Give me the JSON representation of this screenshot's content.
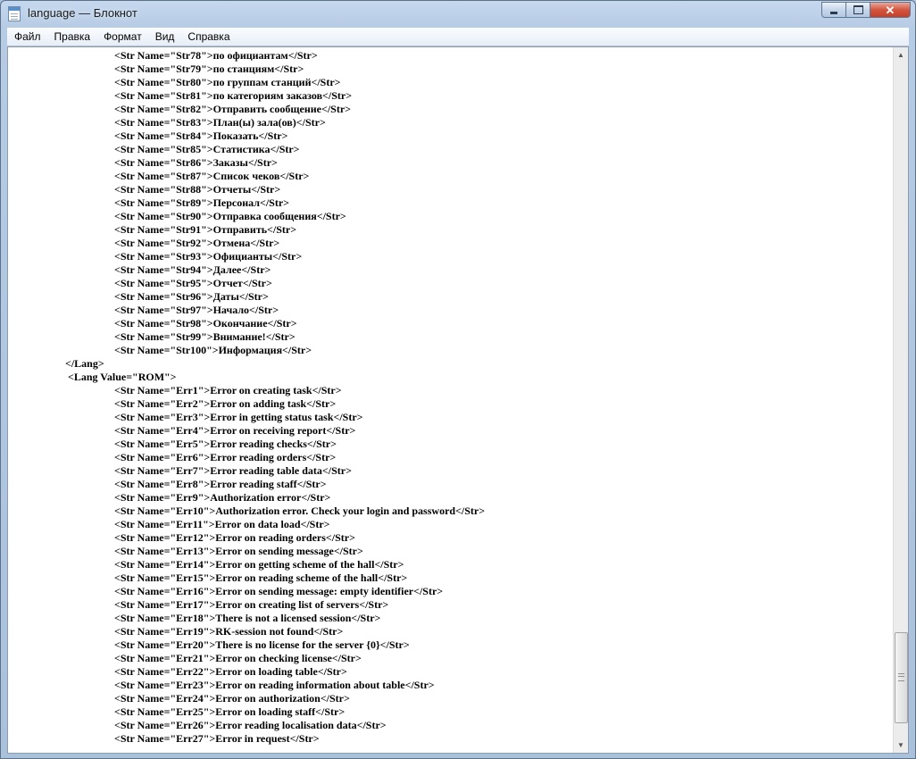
{
  "window": {
    "title": "language — Блокнот",
    "icon": "notepad-icon",
    "controls": {
      "minimize": "minimize-icon",
      "maximize": "maximize-icon",
      "close_glyph": "✕"
    }
  },
  "menu": [
    {
      "label": "Файл"
    },
    {
      "label": "Правка"
    },
    {
      "label": "Формат"
    },
    {
      "label": "Вид"
    },
    {
      "label": "Справка"
    }
  ],
  "editor": {
    "lines": [
      {
        "indent": 2,
        "text": "<Str Name=\"Str78\">по официантам</Str>"
      },
      {
        "indent": 2,
        "text": "<Str Name=\"Str79\">по станциям</Str>"
      },
      {
        "indent": 2,
        "text": "<Str Name=\"Str80\">по группам станций</Str>"
      },
      {
        "indent": 2,
        "text": "<Str Name=\"Str81\">по категориям заказов</Str>"
      },
      {
        "indent": 2,
        "text": "<Str Name=\"Str82\">Отправить сообщение</Str>"
      },
      {
        "indent": 2,
        "text": "<Str Name=\"Str83\">План(ы) зала(ов)</Str>"
      },
      {
        "indent": 2,
        "text": "<Str Name=\"Str84\">Показать</Str>"
      },
      {
        "indent": 2,
        "text": "<Str Name=\"Str85\">Статистика</Str>"
      },
      {
        "indent": 2,
        "text": "<Str Name=\"Str86\">Заказы</Str>"
      },
      {
        "indent": 2,
        "text": "<Str Name=\"Str87\">Список чеков</Str>"
      },
      {
        "indent": 2,
        "text": "<Str Name=\"Str88\">Отчеты</Str>"
      },
      {
        "indent": 2,
        "text": "<Str Name=\"Str89\">Персонал</Str>"
      },
      {
        "indent": 2,
        "text": "<Str Name=\"Str90\">Отправка сообщения</Str>"
      },
      {
        "indent": 2,
        "text": "<Str Name=\"Str91\">Отправить</Str>"
      },
      {
        "indent": 2,
        "text": "<Str Name=\"Str92\">Отмена</Str>"
      },
      {
        "indent": 2,
        "text": "<Str Name=\"Str93\">Официанты</Str>"
      },
      {
        "indent": 2,
        "text": "<Str Name=\"Str94\">Далее</Str>"
      },
      {
        "indent": 2,
        "text": "<Str Name=\"Str95\">Отчет</Str>"
      },
      {
        "indent": 2,
        "text": "<Str Name=\"Str96\">Даты</Str>"
      },
      {
        "indent": 2,
        "text": "<Str Name=\"Str97\">Начало</Str>"
      },
      {
        "indent": 2,
        "text": "<Str Name=\"Str98\">Окончание</Str>"
      },
      {
        "indent": 2,
        "text": "<Str Name=\"Str99\">Внимание!</Str>"
      },
      {
        "indent": 2,
        "text": "<Str Name=\"Str100\">Информация</Str>"
      },
      {
        "indent": 1,
        "text": "</Lang>"
      },
      {
        "indent": 1,
        "text": " <Lang Value=\"ROM\">"
      },
      {
        "indent": 2,
        "text": "<Str Name=\"Err1\">Error on creating task</Str>"
      },
      {
        "indent": 2,
        "text": "<Str Name=\"Err2\">Error on adding task</Str>"
      },
      {
        "indent": 2,
        "text": "<Str Name=\"Err3\">Error in getting status task</Str>"
      },
      {
        "indent": 2,
        "text": "<Str Name=\"Err4\">Error on receiving report</Str>"
      },
      {
        "indent": 2,
        "text": "<Str Name=\"Err5\">Error reading checks</Str>"
      },
      {
        "indent": 2,
        "text": "<Str Name=\"Err6\">Error reading orders</Str>"
      },
      {
        "indent": 2,
        "text": "<Str Name=\"Err7\">Error reading table data</Str>"
      },
      {
        "indent": 2,
        "text": "<Str Name=\"Err8\">Error reading staff</Str>"
      },
      {
        "indent": 2,
        "text": "<Str Name=\"Err9\">Authorization error</Str>"
      },
      {
        "indent": 2,
        "text": "<Str Name=\"Err10\">Authorization error. Check your login and password</Str>"
      },
      {
        "indent": 2,
        "text": "<Str Name=\"Err11\">Error on data load</Str>"
      },
      {
        "indent": 2,
        "text": "<Str Name=\"Err12\">Error on reading orders</Str>"
      },
      {
        "indent": 2,
        "text": "<Str Name=\"Err13\">Error on sending message</Str>"
      },
      {
        "indent": 2,
        "text": "<Str Name=\"Err14\">Error on getting scheme of the hall</Str>"
      },
      {
        "indent": 2,
        "text": "<Str Name=\"Err15\">Error on reading scheme of the hall</Str>"
      },
      {
        "indent": 2,
        "text": "<Str Name=\"Err16\">Error on sending message: empty identifier</Str>"
      },
      {
        "indent": 2,
        "text": "<Str Name=\"Err17\">Error on creating list of servers</Str>"
      },
      {
        "indent": 2,
        "text": "<Str Name=\"Err18\">There is not a licensed session</Str>"
      },
      {
        "indent": 2,
        "text": "<Str Name=\"Err19\">RK-session not found</Str>"
      },
      {
        "indent": 2,
        "text": "<Str Name=\"Err20\">There is no license for the server {0}</Str>"
      },
      {
        "indent": 2,
        "text": "<Str Name=\"Err21\">Error on checking license</Str>"
      },
      {
        "indent": 2,
        "text": "<Str Name=\"Err22\">Error on loading table</Str>"
      },
      {
        "indent": 2,
        "text": "<Str Name=\"Err23\">Error on reading information about table</Str>"
      },
      {
        "indent": 2,
        "text": "<Str Name=\"Err24\">Error on authorization</Str>"
      },
      {
        "indent": 2,
        "text": "<Str Name=\"Err25\">Error on loading staff</Str>"
      },
      {
        "indent": 2,
        "text": "<Str Name=\"Err26\">Error reading localisation data</Str>"
      },
      {
        "indent": 2,
        "text": "<Str Name=\"Err27\">Error in request</Str>"
      }
    ]
  },
  "scrollbar": {
    "up_icon": "▲",
    "down_icon": "▼"
  }
}
